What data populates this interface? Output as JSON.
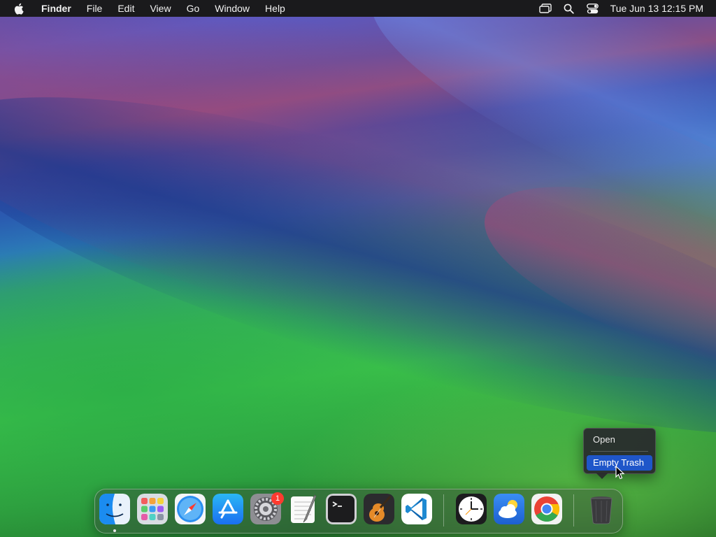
{
  "menubar": {
    "app_name": "Finder",
    "items": [
      "File",
      "Edit",
      "View",
      "Go",
      "Window",
      "Help"
    ],
    "status_icons": [
      "screen-mirroring-icon",
      "spotlight-search-icon",
      "control-center-icon"
    ],
    "clock": "Tue Jun 13  12:15 PM"
  },
  "context_menu": {
    "items": [
      {
        "label": "Open",
        "highlighted": false
      },
      {
        "label": "Empty Trash",
        "highlighted": true
      }
    ],
    "highlight_color": "#1f56c9"
  },
  "dock": {
    "apps": [
      {
        "name": "Finder",
        "icon": "finder-icon",
        "running": true
      },
      {
        "name": "Launchpad",
        "icon": "launchpad-icon"
      },
      {
        "name": "Safari",
        "icon": "safari-icon"
      },
      {
        "name": "App Store",
        "icon": "app-store-icon"
      },
      {
        "name": "System Settings",
        "icon": "system-settings-icon",
        "badge": "1"
      },
      {
        "name": "TextEdit",
        "icon": "textedit-icon"
      },
      {
        "name": "Terminal",
        "icon": "terminal-icon"
      },
      {
        "name": "GarageBand",
        "icon": "garageband-icon"
      },
      {
        "name": "Visual Studio Code",
        "icon": "vscode-icon"
      },
      {
        "name": "Clock",
        "icon": "clock-icon"
      },
      {
        "name": "Weather",
        "icon": "weather-icon"
      },
      {
        "name": "Google Chrome",
        "icon": "chrome-icon"
      },
      {
        "name": "Trash",
        "icon": "trash-icon"
      }
    ]
  },
  "colors": {
    "menubar_bg": "#1a1a1c",
    "badge": "#ff3b30"
  }
}
